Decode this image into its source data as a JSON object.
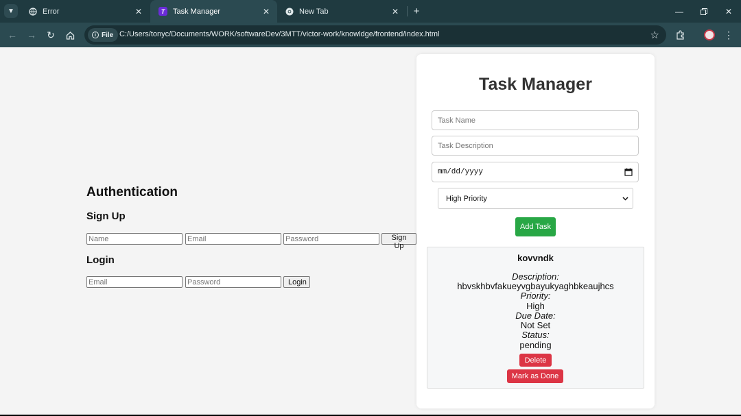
{
  "browser": {
    "tabs": [
      {
        "label": "Error",
        "icon": "globe-icon"
      },
      {
        "label": "Task Manager",
        "icon": "task-manager-favicon",
        "active": true
      },
      {
        "label": "New Tab",
        "icon": "chrome-icon"
      }
    ],
    "scheme_chip": "File",
    "url": "C:/Users/tonyc/Documents/WORK/softwareDev/3MTT/victor-work/knowldge/frontend/index.html",
    "favicon_letter": "T"
  },
  "auth": {
    "title": "Authentication",
    "signup": {
      "heading": "Sign Up",
      "name_placeholder": "Name",
      "email_placeholder": "Email",
      "password_placeholder": "Password",
      "button": "Sign Up"
    },
    "login": {
      "heading": "Login",
      "email_placeholder": "Email",
      "password_placeholder": "Password",
      "button": "Login"
    }
  },
  "task_manager": {
    "title": "Task Manager",
    "task_name_placeholder": "Task Name",
    "task_description_placeholder": "Task Description",
    "date_placeholder": "mm/dd/yyyy",
    "priority_selected": "High Priority",
    "add_button": "Add Task",
    "tasks": [
      {
        "name": "kovvndk",
        "description_label": "Description:",
        "description": "hbvskhbvfakueyvgbayukyaghbkeaujhcs",
        "priority_label": "Priority:",
        "priority": "High",
        "due_label": "Due Date:",
        "due": "Not Set",
        "status_label": "Status:",
        "status": "pending",
        "delete_button": "Delete",
        "done_button": "Mark as Done"
      }
    ]
  },
  "colors": {
    "tabstrip": "#1f3a40",
    "toolbar": "#2b4a51",
    "add_button": "#28a745",
    "danger_button": "#dc3545",
    "page_bg": "#f4f4f4"
  }
}
